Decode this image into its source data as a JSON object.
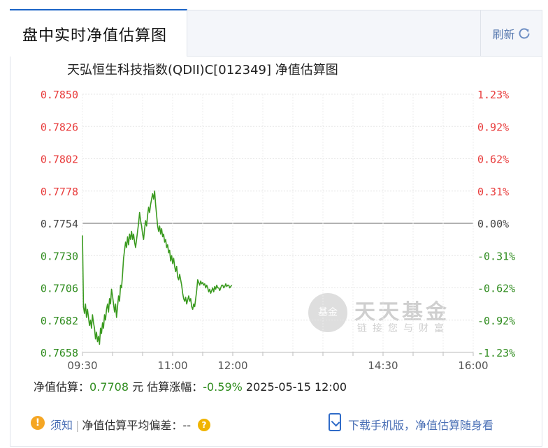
{
  "tab": {
    "title": "盘中实时净值估算图"
  },
  "refresh": {
    "label": "刷新"
  },
  "chart": {
    "title": "天弘恒生科技指数(QDII)C[012349] 净值估算图"
  },
  "chart_data": {
    "type": "line",
    "title": "天弘恒生科技指数(QDII)C[012349] 净值估算图",
    "ylim": [
      0.7658,
      0.785
    ],
    "base_value": 0.7754,
    "y_left_ticks": [
      "0.7850",
      "0.7826",
      "0.7802",
      "0.7778",
      "0.7754",
      "0.7730",
      "0.7706",
      "0.7682",
      "0.7658"
    ],
    "y_right_ticks": [
      "1.23%",
      "0.92%",
      "0.62%",
      "0.31%",
      "0.00%",
      "-0.31%",
      "-0.62%",
      "-0.92%",
      "-1.23%"
    ],
    "x_ticks": [
      "09:30",
      "11:00",
      "12:00",
      "14:30",
      "16:00"
    ],
    "x_tick_minutes": [
      0,
      90,
      150,
      300,
      390
    ],
    "grid": true,
    "colors": {
      "up": "#e83b3b",
      "down": "#2f8c1e",
      "zero": "#444444",
      "line": "#3a9a1f"
    },
    "series": [
      {
        "points": [
          [
            0,
            0.7745
          ],
          [
            1,
            0.7692
          ],
          [
            2,
            0.7687
          ],
          [
            3,
            0.7694
          ],
          [
            4,
            0.7684
          ],
          [
            5,
            0.769
          ],
          [
            6,
            0.7684
          ],
          [
            7,
            0.7678
          ],
          [
            8,
            0.7682
          ],
          [
            9,
            0.7676
          ],
          [
            10,
            0.7686
          ],
          [
            11,
            0.768
          ],
          [
            12,
            0.7676
          ],
          [
            13,
            0.7668
          ],
          [
            14,
            0.7673
          ],
          [
            15,
            0.7666
          ],
          [
            16,
            0.767
          ],
          [
            17,
            0.7664
          ],
          [
            18,
            0.7676
          ],
          [
            19,
            0.7672
          ],
          [
            20,
            0.768
          ],
          [
            21,
            0.7676
          ],
          [
            22,
            0.7686
          ],
          [
            23,
            0.7682
          ],
          [
            24,
            0.769
          ],
          [
            25,
            0.7694
          ],
          [
            26,
            0.7688
          ],
          [
            27,
            0.7698
          ],
          [
            28,
            0.7694
          ],
          [
            29,
            0.7705
          ],
          [
            30,
            0.77
          ],
          [
            31,
            0.7694
          ],
          [
            32,
            0.7688
          ],
          [
            33,
            0.7694
          ],
          [
            34,
            0.7684
          ],
          [
            35,
            0.7692
          ],
          [
            36,
            0.77
          ],
          [
            37,
            0.7696
          ],
          [
            38,
            0.7708
          ],
          [
            39,
            0.7706
          ],
          [
            40,
            0.7716
          ],
          [
            41,
            0.7728
          ],
          [
            42,
            0.7734
          ],
          [
            43,
            0.774
          ],
          [
            44,
            0.7736
          ],
          [
            45,
            0.7744
          ],
          [
            46,
            0.7738
          ],
          [
            47,
            0.7746
          ],
          [
            48,
            0.7742
          ],
          [
            49,
            0.7748
          ],
          [
            50,
            0.7742
          ],
          [
            51,
            0.7746
          ],
          [
            52,
            0.774
          ],
          [
            53,
            0.7736
          ],
          [
            54,
            0.7742
          ],
          [
            55,
            0.7748
          ],
          [
            56,
            0.7754
          ],
          [
            57,
            0.7762
          ],
          [
            58,
            0.7756
          ],
          [
            59,
            0.7752
          ],
          [
            60,
            0.7746
          ],
          [
            61,
            0.7742
          ],
          [
            62,
            0.775
          ],
          [
            63,
            0.7756
          ],
          [
            64,
            0.7752
          ],
          [
            65,
            0.776
          ],
          [
            66,
            0.7766
          ],
          [
            67,
            0.7762
          ],
          [
            68,
            0.7768
          ],
          [
            69,
            0.7772
          ],
          [
            70,
            0.7776
          ],
          [
            71,
            0.7772
          ],
          [
            72,
            0.7778
          ],
          [
            73,
            0.7768
          ],
          [
            74,
            0.776
          ],
          [
            75,
            0.7752
          ],
          [
            76,
            0.7748
          ],
          [
            77,
            0.7752
          ],
          [
            78,
            0.7746
          ],
          [
            79,
            0.775
          ],
          [
            80,
            0.7744
          ],
          [
            81,
            0.7746
          ],
          [
            82,
            0.774
          ],
          [
            83,
            0.7742
          ],
          [
            84,
            0.7736
          ],
          [
            85,
            0.7738
          ],
          [
            86,
            0.7732
          ],
          [
            87,
            0.7734
          ],
          [
            88,
            0.7726
          ],
          [
            89,
            0.773
          ],
          [
            90,
            0.7724
          ],
          [
            91,
            0.7728
          ],
          [
            92,
            0.7722
          ],
          [
            93,
            0.7718
          ],
          [
            94,
            0.7722
          ],
          [
            95,
            0.7714
          ],
          [
            96,
            0.7712
          ],
          [
            97,
            0.7716
          ],
          [
            98,
            0.7712
          ],
          [
            99,
            0.7708
          ],
          [
            100,
            0.7702
          ],
          [
            101,
            0.7698
          ],
          [
            102,
            0.7696
          ],
          [
            103,
            0.7699
          ],
          [
            104,
            0.7694
          ],
          [
            105,
            0.7697
          ],
          [
            106,
            0.77
          ],
          [
            107,
            0.7696
          ],
          [
            108,
            0.7698
          ],
          [
            109,
            0.7692
          ],
          [
            110,
            0.769
          ],
          [
            111,
            0.7694
          ],
          [
            112,
            0.7692
          ],
          [
            113,
            0.7698
          ],
          [
            114,
            0.7704
          ],
          [
            115,
            0.7712
          ],
          [
            116,
            0.771
          ],
          [
            117,
            0.7708
          ],
          [
            118,
            0.7711
          ],
          [
            119,
            0.7709
          ],
          [
            120,
            0.771
          ],
          [
            121,
            0.7708
          ],
          [
            122,
            0.7709
          ],
          [
            123,
            0.7706
          ],
          [
            124,
            0.7708
          ],
          [
            125,
            0.7706
          ],
          [
            126,
            0.7703
          ],
          [
            127,
            0.7705
          ],
          [
            128,
            0.7702
          ],
          [
            129,
            0.7704
          ],
          [
            130,
            0.7706
          ],
          [
            131,
            0.7703
          ],
          [
            132,
            0.7707
          ],
          [
            133,
            0.7705
          ],
          [
            134,
            0.7708
          ],
          [
            135,
            0.7706
          ],
          [
            136,
            0.7706
          ],
          [
            137,
            0.7704
          ],
          [
            138,
            0.7706
          ],
          [
            139,
            0.7708
          ],
          [
            140,
            0.7708
          ],
          [
            141,
            0.7706
          ],
          [
            142,
            0.7707
          ],
          [
            143,
            0.7709
          ],
          [
            144,
            0.7707
          ],
          [
            145,
            0.7708
          ],
          [
            146,
            0.7708
          ],
          [
            147,
            0.7706
          ],
          [
            148,
            0.7707
          ],
          [
            149,
            0.7708
          ]
        ]
      }
    ]
  },
  "info": {
    "nav_label": "净值估算：",
    "nav_value": "0.7708",
    "nav_unit": "元",
    "change_label": "估算涨幅：",
    "change_value": "-0.59%",
    "timestamp": "2025-05-15 12:00"
  },
  "footer": {
    "notice": "须知",
    "deviation_label": "净值估算平均偏差：",
    "deviation_value": "--",
    "download": "下载手机版，净值估算随身看"
  },
  "watermark": {
    "logo": "基金",
    "brand": "天天基金",
    "slogan": "链接您与财富"
  }
}
